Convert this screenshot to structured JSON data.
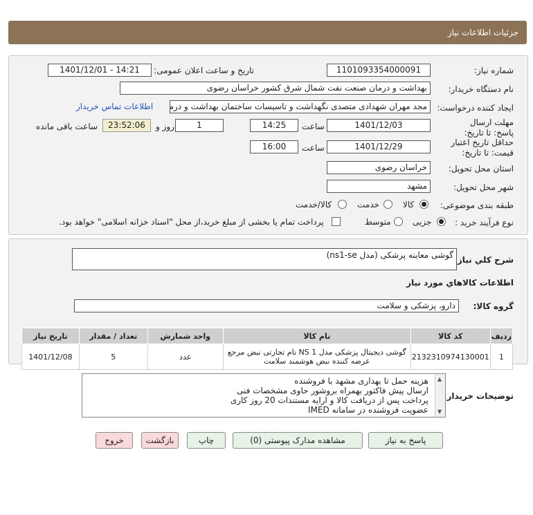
{
  "header": {
    "title": "جزئیات اطلاعات نیاز"
  },
  "labels": {
    "need_number": "شماره نیاز:",
    "announce_datetime": "تاریخ و ساعت اعلان عمومی:",
    "buyer_org": "نام دستگاه خریدار:",
    "requester": "ایجاد کننده درخواست:",
    "deadline_send": "مهلت ارسال پاسخ: تا تاریخ:",
    "time": "ساعت",
    "days_and": "روز و",
    "remaining": "ساعت باقی مانده",
    "validity": "حداقل تاریخ اعتبار قیمت: تا تاریخ:",
    "delivery_province": "استان محل تحویل:",
    "delivery_city": "شهر محل تحویل:",
    "category": "طبقه بندی موضوعی:",
    "purchase_type": "نوع فرآیند خرید :",
    "general_desc": "شرح کلي نياز:",
    "goods_info": "اطلاعات کالاهاي مورد نياز",
    "goods_group": "گروه کالا:",
    "buyer_notes": "توضیحات خریدار:"
  },
  "values": {
    "need_number": "1101093354000091",
    "announce_datetime": "1401/12/01 - 14:21",
    "buyer_org": "بهداشت و درمان صنعت نفت شمال شرق کشور   خراسان رضوی",
    "requester": "مجد مهران شهدادی متصدی نگهداشت و تاسیسات ساختمان بهداشت و درمان",
    "contact_link": "اطلاعات تماس خریدار",
    "deadline_date": "1401/12/03",
    "deadline_time": "14:25",
    "days": "1",
    "remaining_time": "23:52:06",
    "validity_date": "1401/12/29",
    "validity_time": "16:00",
    "province": "خراسان رضوی",
    "city": "مشهد",
    "general_desc": "گوشی معاینه پزشکی (مدل ns1-se)",
    "goods_group": "دارو، پزشکی و سلامت"
  },
  "category_options": [
    "کالا",
    "خدمت",
    "کالا/خدمت"
  ],
  "category_selected": "کالا",
  "purchase_options": [
    "جزیی",
    "متوسط"
  ],
  "purchase_selected": "جزیی",
  "payment_note": "پرداخت تمام یا بخشی از مبلغ خرید،از محل \"اسناد خزانه اسلامی\" خواهد بود.",
  "table": {
    "headers": [
      "ردیف",
      "کد کالا",
      "نام کالا",
      "واحد شمارش",
      "تعداد / مقدار",
      "تاریخ نیاز"
    ],
    "rows": [
      {
        "row": "1",
        "code": "2132310974130001",
        "name_line1": "گوشی دیجیتال پزشکی مدل NS 1 نام تجارتی نبض مرجع",
        "name_line2": "عرضه کننده نبض هوشمند سلامت",
        "unit": "عدد",
        "qty": "5",
        "date": "1401/12/08"
      }
    ]
  },
  "notes": [
    "هزینه حمل تا بهداری مشهد با فروشنده",
    "ارسال پیش فاکتور بهمراه بروشور حاوی مشخصات فنی",
    "پرداخت پس از دریافت کالا و ارایه مستندات 20 روز کاری",
    "عضویت فروشنده در سامانه IMED"
  ],
  "buttons": {
    "reply": "پاسخ به نیاز",
    "attachments": "مشاهده مدارک پیوستی (0)",
    "print": "چاپ",
    "back": "بازگشت",
    "exit": "خروج"
  }
}
